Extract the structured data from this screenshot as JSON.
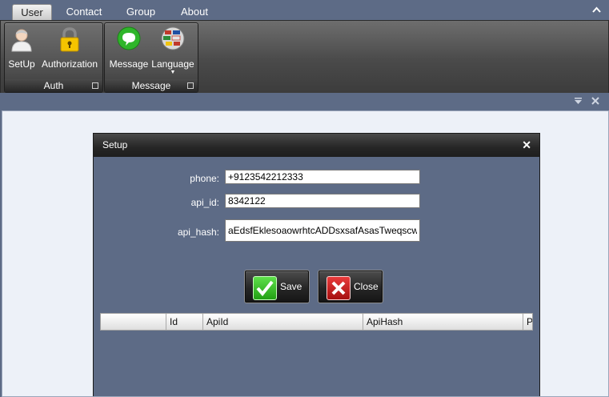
{
  "ribbon": {
    "tabs": [
      {
        "label": "User",
        "active": true
      },
      {
        "label": "Contact",
        "active": false
      },
      {
        "label": "Group",
        "active": false
      },
      {
        "label": "About",
        "active": false
      }
    ],
    "collapse_icon": "chevron-up-icon",
    "groups": [
      {
        "caption": "Auth",
        "buttons": [
          {
            "label": "SetUp",
            "icon": "user-icon"
          },
          {
            "label": "Authorization",
            "icon": "lock-icon"
          }
        ]
      },
      {
        "caption": "Message",
        "buttons": [
          {
            "label": "Message",
            "icon": "chat-bubble-icon"
          },
          {
            "label": "Language",
            "icon": "flags-globe-icon"
          }
        ]
      }
    ]
  },
  "document_tools": {
    "dropdown_icon": "dropdown-icon",
    "close_icon": "close-icon"
  },
  "dialog": {
    "title": "Setup",
    "close_symbol": "✕",
    "fields": {
      "phone": {
        "label": "phone:",
        "value": "+9123542212333"
      },
      "api_id": {
        "label": "api_id:",
        "value": "8342122"
      },
      "api_hash": {
        "label": "api_hash:",
        "value": "aEdsfEklesoaowrhtcADDsxsafAsasTweqscw"
      }
    },
    "buttons": {
      "save": {
        "label": "Save",
        "icon": "checkmark-icon"
      },
      "close": {
        "label": "Close",
        "icon": "red-x-icon"
      }
    },
    "grid": {
      "columns": [
        "",
        "Id",
        "ApiId",
        "ApiHash",
        "Ph"
      ]
    }
  },
  "colors": {
    "background": "#5d6b86",
    "ribbon_dark": "#262626",
    "doc_area": "#edf1f8",
    "save_green": "#33b51f",
    "close_red": "#c81b1b"
  }
}
